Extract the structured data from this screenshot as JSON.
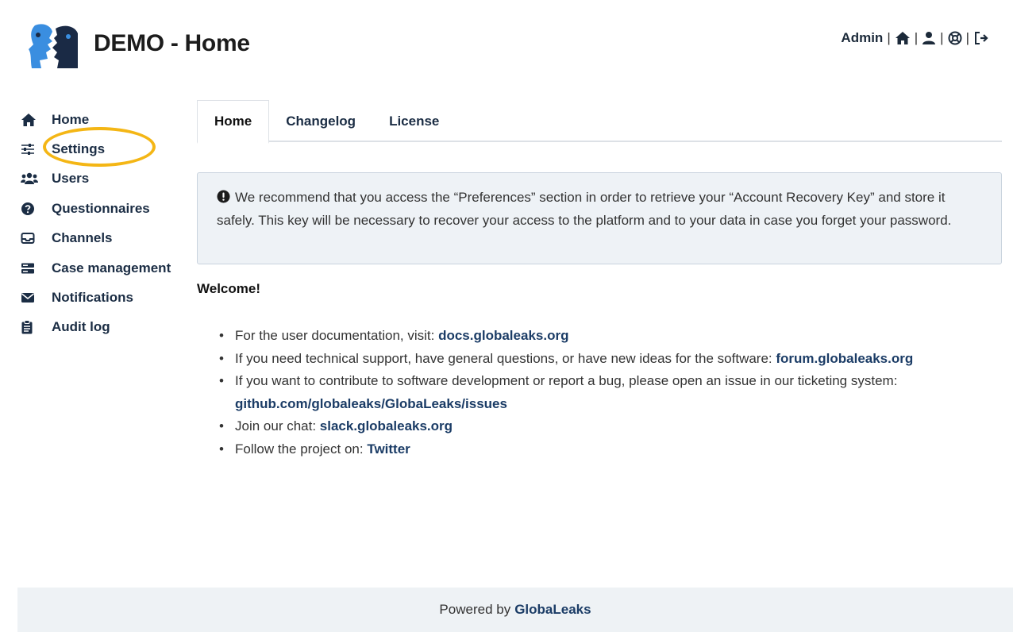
{
  "header": {
    "title": "DEMO - Home",
    "user_label": "Admin",
    "separator": "|"
  },
  "sidebar": {
    "items": [
      {
        "label": "Home",
        "icon": "home-icon"
      },
      {
        "label": "Settings",
        "icon": "sliders-icon"
      },
      {
        "label": "Users",
        "icon": "users-icon"
      },
      {
        "label": "Questionnaires",
        "icon": "question-circle-icon"
      },
      {
        "label": "Channels",
        "icon": "inbox-icon"
      },
      {
        "label": "Case management",
        "icon": "server-icon"
      },
      {
        "label": "Notifications",
        "icon": "envelope-icon"
      },
      {
        "label": "Audit log",
        "icon": "clipboard-icon"
      }
    ]
  },
  "tabs": [
    {
      "label": "Home",
      "active": true
    },
    {
      "label": "Changelog",
      "active": false
    },
    {
      "label": "License",
      "active": false
    }
  ],
  "alert": {
    "text": "We recommend that you access the “Preferences” section in order to retrieve your “Account Recovery Key” and store it safely. This key will be necessary to recover your access to the platform and to your data in case you forget your password."
  },
  "welcome": "Welcome!",
  "info": {
    "item1_text": "For the user documentation, visit:",
    "item1_link": "docs.globaleaks.org",
    "item2_text": "If you need technical support, have general questions, or have new ideas for the software:",
    "item2_link": "forum.globaleaks.org",
    "item3_text": "If you want to contribute to software development or report a bug, please open an issue in our ticketing system:",
    "item3_link": "github.com/globaleaks/GlobaLeaks/issues",
    "item4_text": "Join our chat:",
    "item4_link": "slack.globaleaks.org",
    "item5_text": "Follow the project on:",
    "item5_link": "Twitter"
  },
  "footer": {
    "text": "Powered by",
    "link": "GlobaLeaks"
  },
  "colors": {
    "nav_text": "#1b2d44",
    "logo_blue": "#3a8ee0",
    "logo_dark": "#1a2a45",
    "highlight": "#f4b615",
    "alert_bg": "#eef2f6",
    "footer_bg": "#eef2f5"
  }
}
